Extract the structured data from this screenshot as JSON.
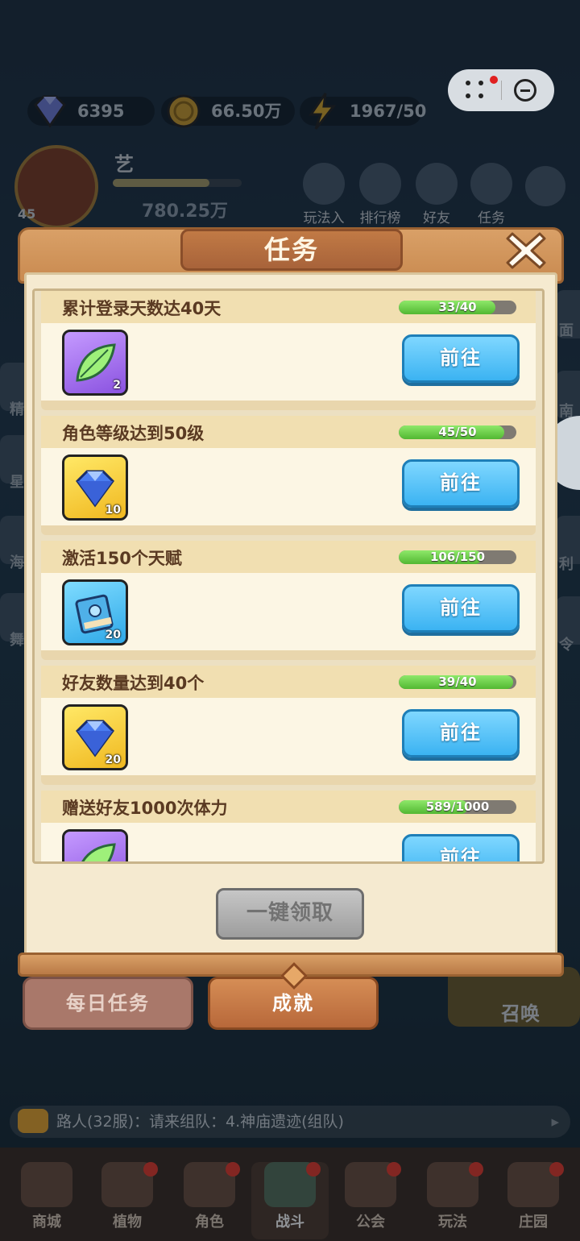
{
  "resources": [
    {
      "icon": "diamond-icon",
      "value": "6395"
    },
    {
      "icon": "gold-coin-icon",
      "value": "66.50万"
    },
    {
      "icon": "energy-bolt-icon",
      "value": "1967/50"
    }
  ],
  "player": {
    "name": "艺",
    "level": "45",
    "power": "780.25万"
  },
  "top_buttons": [
    "玩法入口",
    "排行榜",
    "好友",
    "任务"
  ],
  "side_left": [
    "精",
    "星",
    "海",
    "舞"
  ],
  "side_right": [
    "面",
    "南",
    "利",
    "令"
  ],
  "panel": {
    "title": "任务",
    "tasks": [
      {
        "name": "累计登录天数达40天",
        "progress_text": "33/40",
        "progress": 0.825,
        "reward_icon": "green-leaf-icon",
        "reward_count": "2",
        "button": "前往"
      },
      {
        "name": "角色等级达到50级",
        "progress_text": "45/50",
        "progress": 0.9,
        "reward_icon": "blue-diamond-icon",
        "reward_count": "10",
        "button": "前往"
      },
      {
        "name": "激活150个天赋",
        "progress_text": "106/150",
        "progress": 0.7067,
        "reward_icon": "blue-book-icon",
        "reward_count": "20",
        "button": "前往"
      },
      {
        "name": "好友数量达到40个",
        "progress_text": "39/40",
        "progress": 0.975,
        "reward_icon": "blue-diamond-icon",
        "reward_count": "20",
        "button": "前往"
      },
      {
        "name": "赠送好友1000次体力",
        "progress_text": "589/1000",
        "progress": 0.589,
        "reward_icon": "green-leaf-icon",
        "reward_count": "",
        "button": "前往"
      }
    ],
    "claim_all": "一键领取"
  },
  "tabs": {
    "daily": "每日任务",
    "achievement": "成就"
  },
  "summon": "召唤",
  "chat": {
    "text": "路人(32服)：请来组队：4.神庙遗迹(组队)"
  },
  "nav": [
    {
      "label": "商城",
      "icon": "shop-icon"
    },
    {
      "label": "植物",
      "icon": "plant-icon"
    },
    {
      "label": "角色",
      "icon": "character-icon"
    },
    {
      "label": "战斗",
      "icon": "battle-icon"
    },
    {
      "label": "公会",
      "icon": "guild-icon"
    },
    {
      "label": "玩法",
      "icon": "gameplay-icon"
    },
    {
      "label": "庄园",
      "icon": "manor-icon"
    }
  ],
  "colors": {
    "accent_blue": "#3bb3f2",
    "progress_green": "#52b832",
    "wood": "#c98a50",
    "parchment": "#f5ead0"
  }
}
